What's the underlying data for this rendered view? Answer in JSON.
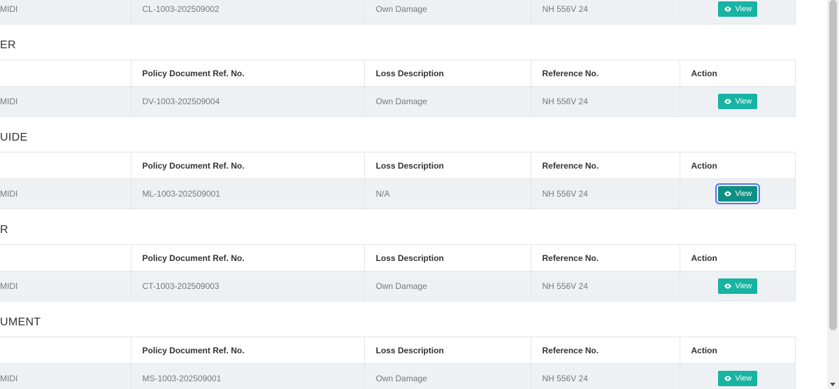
{
  "colors": {
    "button": "#17b3a3",
    "button_focused": "#0f8f84",
    "focus_ring": "#5a72f2",
    "row_bg": "#eef1f4"
  },
  "view_icon": "eye-icon",
  "sections": [
    {
      "title": "",
      "show_header": false,
      "headers": [
        "",
        "Policy Document Ref. No.",
        "Loss Description",
        "Reference No.",
        "Action"
      ],
      "rows": [
        {
          "type": "MIDI",
          "policy_ref": "CL-1003-202509002",
          "loss": "Own Damage",
          "reference": "NH 556V 24",
          "action": "View"
        }
      ]
    },
    {
      "title": "ER",
      "show_header": true,
      "headers": [
        "",
        "Policy Document Ref. No.",
        "Loss Description",
        "Reference No.",
        "Action"
      ],
      "rows": [
        {
          "type": "MIDI",
          "policy_ref": "DV-1003-202509004",
          "loss": "Own Damage",
          "reference": "NH 556V 24",
          "action": "View"
        }
      ]
    },
    {
      "title": "UIDE",
      "show_header": true,
      "headers": [
        "",
        "Policy Document Ref. No.",
        "Loss Description",
        "Reference No.",
        "Action"
      ],
      "rows": [
        {
          "type": "MIDI",
          "policy_ref": "ML-1003-202509001",
          "loss": "N/A",
          "reference": "NH 556V 24",
          "action": "View",
          "focused": true
        }
      ]
    },
    {
      "title": "R",
      "show_header": true,
      "headers": [
        "",
        "Policy Document Ref. No.",
        "Loss Description",
        "Reference No.",
        "Action"
      ],
      "rows": [
        {
          "type": "MIDI",
          "policy_ref": "CT-1003-202509003",
          "loss": "Own Damage",
          "reference": "NH 556V 24",
          "action": "View"
        }
      ]
    },
    {
      "title": "UMENT",
      "show_header": true,
      "headers": [
        "",
        "Policy Document Ref. No.",
        "Loss Description",
        "Reference No.",
        "Action"
      ],
      "rows": [
        {
          "type": "MIDI",
          "policy_ref": "MS-1003-202509001",
          "loss": "Own Damage",
          "reference": "NH 556V 24",
          "action": "View"
        }
      ]
    }
  ]
}
